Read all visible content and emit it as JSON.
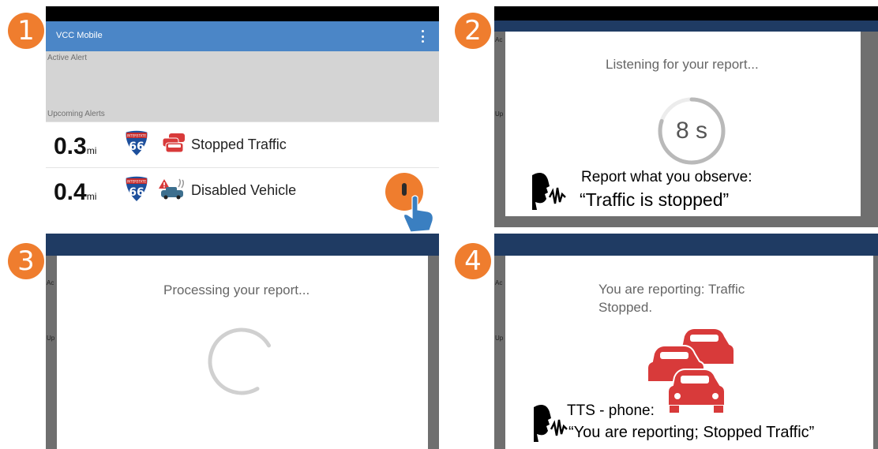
{
  "steps": [
    "1",
    "2",
    "3",
    "4"
  ],
  "panel1": {
    "app_title": "VCC Mobile",
    "active_alert_label": "Active Alert",
    "upcoming_label": "Upcoming Alerts",
    "alerts": [
      {
        "distance": "0.3",
        "unit": "mi",
        "route": "66",
        "route_label": "INTERSTATE",
        "text": "Stopped Traffic"
      },
      {
        "distance": "0.4",
        "unit": "mi",
        "route": "66",
        "route_label": "INTERSTATE",
        "text": "Disabled Vehicle"
      }
    ]
  },
  "panel2": {
    "strip_a": "Ac",
    "strip_b": "Up",
    "heading": "Listening for your report...",
    "countdown": "8 s",
    "countdown_progress": 0.8,
    "caption_line1": "Report what you observe:",
    "caption_line2": "“Traffic is stopped”"
  },
  "panel3": {
    "strip_a": "Ac",
    "strip_b": "Up",
    "heading": "Processing your report..."
  },
  "panel4": {
    "strip_a": "Ac",
    "strip_b": "Up",
    "heading": "You are reporting: Traffic Stopped.",
    "caption_line1": "TTS - phone:",
    "caption_line2": "“You are reporting; Stopped Traffic”"
  },
  "icons": {
    "shield": "interstate-shield-icon",
    "traffic": "stopped-traffic-icon",
    "disabled": "disabled-vehicle-icon",
    "mic": "microphone-icon",
    "hand": "tap-hand-icon",
    "speaker": "speaking-head-icon"
  },
  "colors": {
    "badge": "#ef7d2e",
    "app_bar": "#4b86c7",
    "traffic_red": "#d83a3a",
    "shield_blue": "#1d4f9c"
  }
}
